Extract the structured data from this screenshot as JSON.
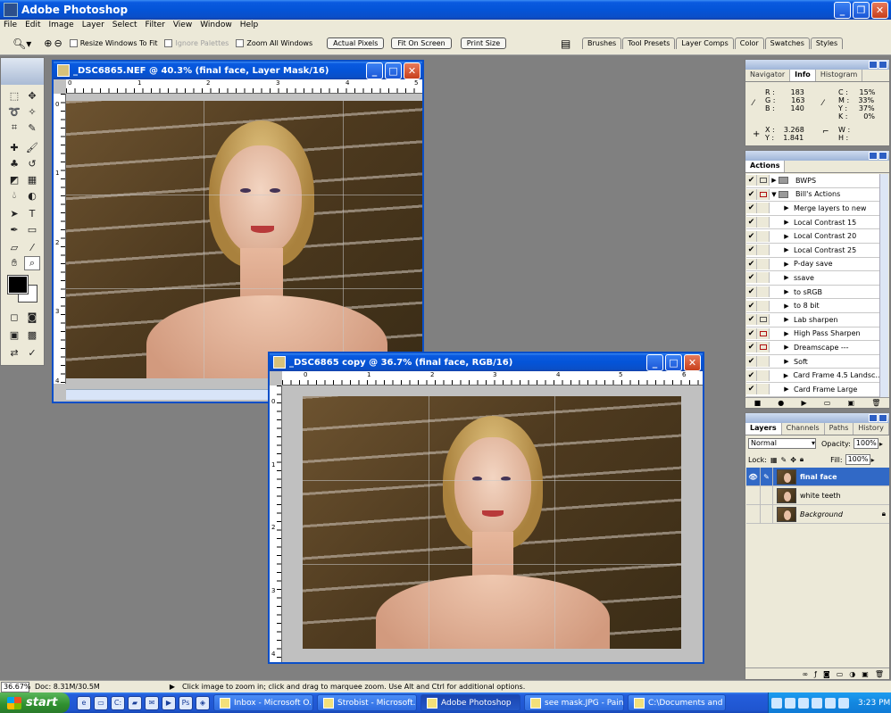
{
  "app": {
    "title": "Adobe Photoshop"
  },
  "menu": [
    "File",
    "Edit",
    "Image",
    "Layer",
    "Select",
    "Filter",
    "View",
    "Window",
    "Help"
  ],
  "options": {
    "resize_windows": "Resize Windows To Fit",
    "ignore_palettes": "Ignore Palettes",
    "zoom_all": "Zoom All Windows",
    "actual_pixels": "Actual Pixels",
    "fit_on_screen": "Fit On Screen",
    "print_size": "Print Size"
  },
  "palette_well": [
    "Brushes",
    "Tool Presets",
    "Layer Comps",
    "Color",
    "Swatches",
    "Styles"
  ],
  "doc1": {
    "title": "_DSC6865.NEF @ 40.3% (final face, Layer Mask/16)",
    "ruler_h": [
      "0",
      "1",
      "2",
      "3",
      "4",
      "5"
    ],
    "ruler_v": [
      "0",
      "1",
      "2",
      "3",
      "4"
    ]
  },
  "doc2": {
    "title": "_DSC6865 copy @ 36.7% (final face, RGB/16)",
    "ruler_h": [
      "0",
      "1",
      "2",
      "3",
      "4",
      "5",
      "6"
    ],
    "ruler_v": [
      "0",
      "1",
      "2",
      "3",
      "4"
    ]
  },
  "info": {
    "tabs": [
      "Navigator",
      "Info",
      "Histogram"
    ],
    "r": "183",
    "g": "163",
    "b": "140",
    "c": "15%",
    "m": "33%",
    "y": "37%",
    "k": "0%",
    "x": "3.268",
    "y_coord": "1.841",
    "w": "",
    "h": ""
  },
  "actions": {
    "title": "Actions",
    "items": [
      {
        "label": "BWPS",
        "type": "set",
        "dialog": "black"
      },
      {
        "label": "Bill's Actions",
        "type": "set-open",
        "dialog": "red"
      },
      {
        "label": "Merge layers to new",
        "type": "action",
        "dialog": ""
      },
      {
        "label": "Local Contrast 15",
        "type": "action",
        "dialog": ""
      },
      {
        "label": "Local Contrast 20",
        "type": "action",
        "dialog": ""
      },
      {
        "label": "Local Contrast 25",
        "type": "action",
        "dialog": ""
      },
      {
        "label": "P-day save",
        "type": "action",
        "dialog": ""
      },
      {
        "label": "ssave",
        "type": "action",
        "dialog": ""
      },
      {
        "label": "to sRGB",
        "type": "action",
        "dialog": ""
      },
      {
        "label": "to 8 bit",
        "type": "action",
        "dialog": ""
      },
      {
        "label": "Lab sharpen",
        "type": "action",
        "dialog": "black"
      },
      {
        "label": "High Pass Sharpen",
        "type": "action",
        "dialog": "red"
      },
      {
        "label": "Dreamscape ---",
        "type": "action",
        "dialog": "red"
      },
      {
        "label": "Soft",
        "type": "action",
        "dialog": ""
      },
      {
        "label": "Card Frame 4.5 Landsc...",
        "type": "action",
        "dialog": ""
      },
      {
        "label": "Card Frame Large",
        "type": "action",
        "dialog": ""
      }
    ]
  },
  "layers": {
    "tabs": [
      "Layers",
      "Channels",
      "Paths",
      "History"
    ],
    "blend_mode": "Normal",
    "opacity_label": "Opacity:",
    "opacity": "100%",
    "lock_label": "Lock:",
    "fill_label": "Fill:",
    "fill": "100%",
    "items": [
      {
        "name": "final face",
        "selected": true,
        "visible": true
      },
      {
        "name": "white teeth",
        "selected": false,
        "visible": false
      },
      {
        "name": "Background",
        "selected": false,
        "visible": false
      }
    ]
  },
  "status": {
    "zoom": "36.67%",
    "doc": "Doc: 8.31M/30.5M",
    "hint": "Click image to zoom in; click and drag to marquee zoom.  Use Alt and Ctrl for additional options."
  },
  "taskbar": {
    "start": "start",
    "tasks": [
      {
        "label": "Inbox - Microsoft O...",
        "active": false
      },
      {
        "label": "Strobist - Microsoft...",
        "active": false
      },
      {
        "label": "Adobe Photoshop",
        "active": true
      },
      {
        "label": "see mask.JPG - Paint",
        "active": false
      },
      {
        "label": "C:\\Documents and ...",
        "active": false
      }
    ],
    "clock": "3:23 PM"
  },
  "colors": {
    "xp_blue": "#0a4fc8",
    "selection": "#3169c6",
    "desktop": "#808080"
  }
}
